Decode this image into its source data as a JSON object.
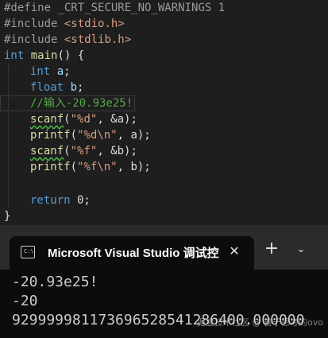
{
  "editor": {
    "lines": [
      {
        "a": "#define",
        "b": " _CRT_SECURE_NO_WARNINGS 1"
      },
      {
        "a": "#include",
        "b": " <stdio.h>"
      },
      {
        "a": "#include",
        "b": " <stdlib.h>"
      },
      {
        "kw": "int",
        "fn": "main",
        "rest": "() {"
      },
      {
        "kw": "int",
        "id": "a",
        "rest": ";"
      },
      {
        "kw": "float",
        "id": "b",
        "rest": ";"
      },
      {
        "comment": "//输入-20.93e25!"
      },
      {
        "fn": "scanf",
        "p1": "(",
        "s": "\"%d\"",
        "rest": ", &a);"
      },
      {
        "fn": "printf",
        "p1": "(",
        "s": "\"%d\\n\"",
        "rest": ", a);"
      },
      {
        "fn": "scanf",
        "p1": "(",
        "s": "\"%f\"",
        "rest": ", &b);"
      },
      {
        "fn": "printf",
        "p1": "(",
        "s": "\"%f\\n\"",
        "rest": ", b);"
      },
      {
        "kw": "return",
        "rest": " 0;"
      },
      {
        "close": "}"
      }
    ]
  },
  "terminal": {
    "tab_title": "Microsoft Visual Studio 调试控",
    "tab_icon_text": "C:\\",
    "close_glyph": "✕",
    "new_tab_glyph": "+",
    "dropdown_glyph": "⌄",
    "output": [
      "-20.93e25!",
      "-20",
      "929999981173696528541286400.000000"
    ]
  },
  "watermark": "掘金技术社区 @ 善于思考的ovo"
}
